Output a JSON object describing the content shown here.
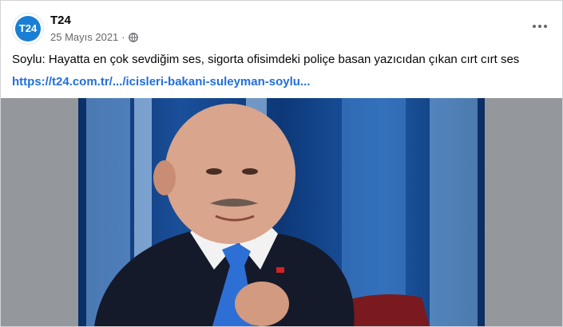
{
  "post": {
    "author": {
      "name": "T24",
      "avatar_text": "T24"
    },
    "date": "25 Mayıs 2021",
    "separator": "·",
    "privacy_icon": "globe-icon",
    "text": "Soylu: Hayatta en çok sevdiğim ses, sigorta ofisimdeki poliçe basan yazıcıdan çıkan cırt cırt ses",
    "link": "https://t24.com.tr/.../icisleri-bakani-suleyman-soylu...",
    "menu_icon": "more-options-icon"
  },
  "colors": {
    "link": "#216fdb",
    "brand": "#1a7fd4",
    "media_background": "#94979c"
  }
}
